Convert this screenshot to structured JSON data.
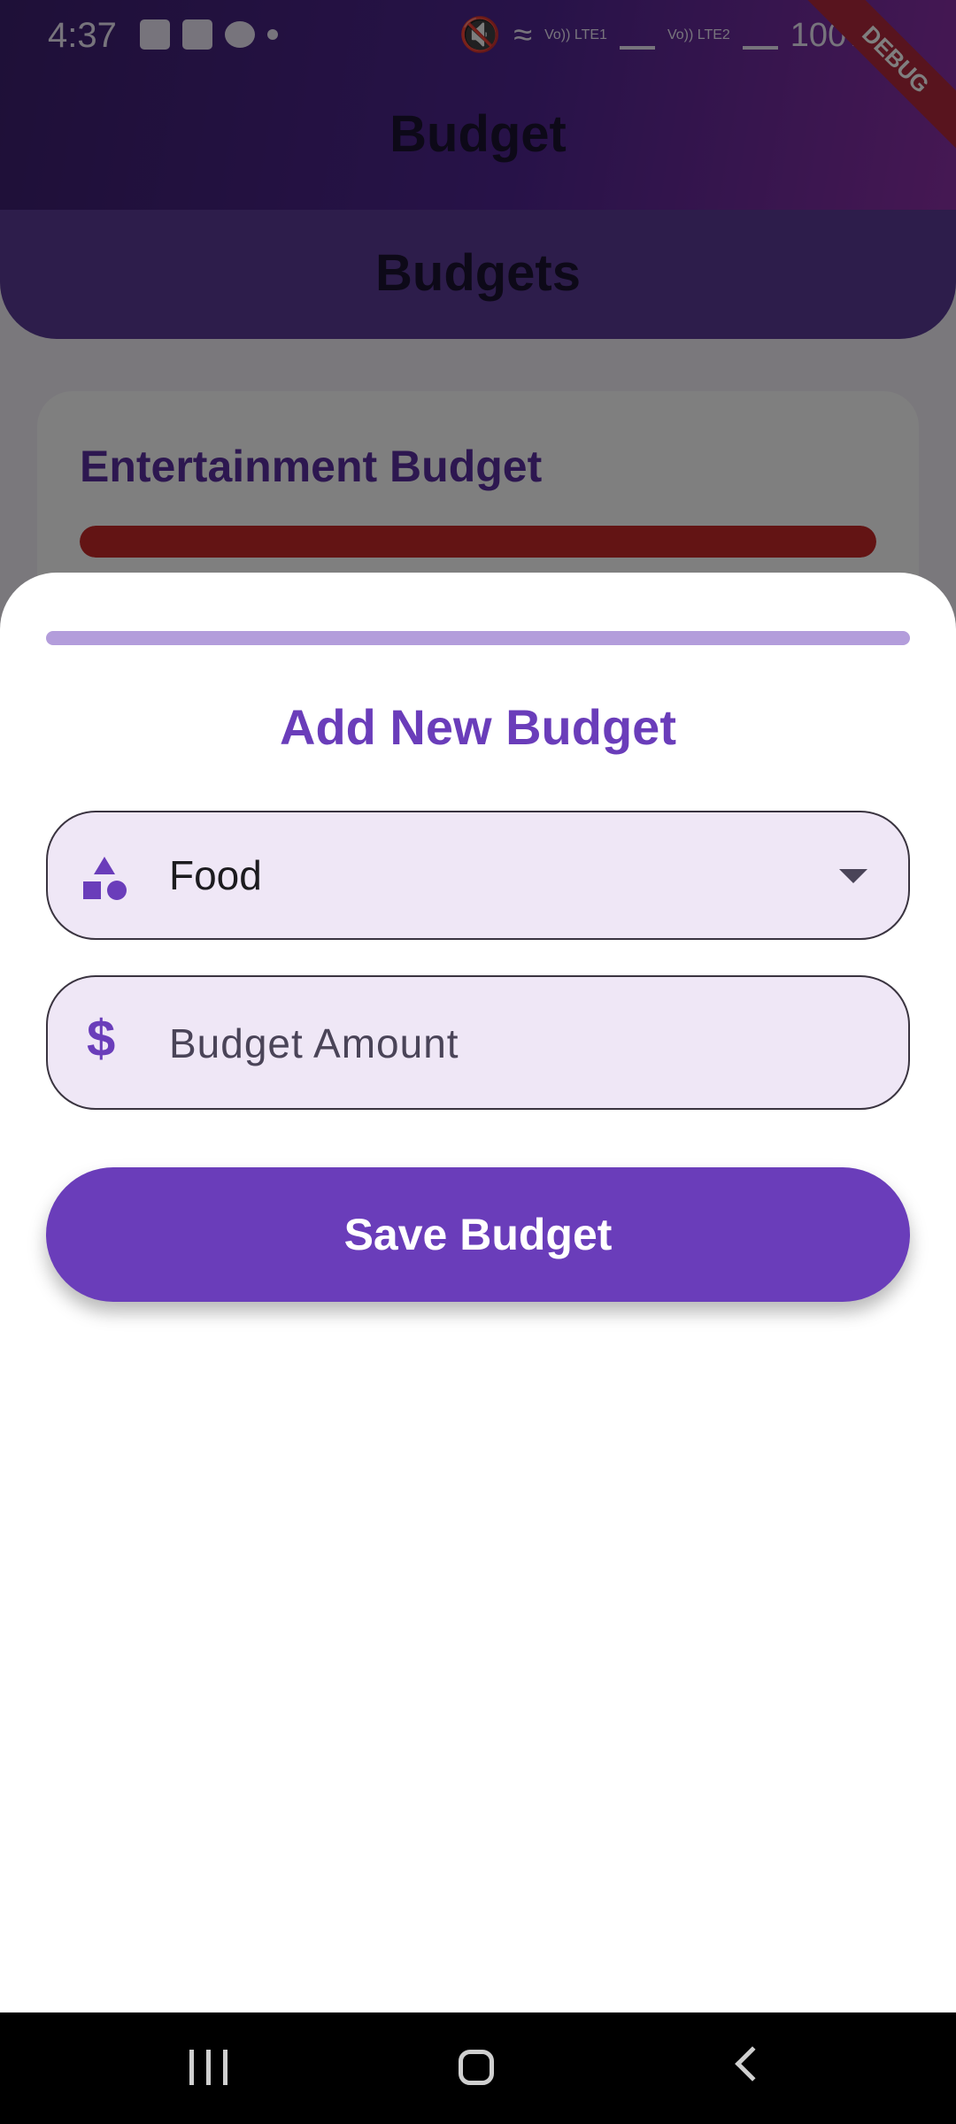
{
  "status_bar": {
    "time": "4:37",
    "battery": "100%",
    "sim1": "Vo)) LTE1",
    "sim2": "Vo)) LTE2",
    "debug_banner": "DEBUG"
  },
  "app_bar": {
    "title": "Budget"
  },
  "header": {
    "title": "Budgets"
  },
  "background_card": {
    "title": "Entertainment Budget",
    "progress": 1.0,
    "progress_color": "#c62828"
  },
  "sheet": {
    "title": "Add New Budget",
    "category": {
      "selected": "Food",
      "icon": "category-shapes-icon"
    },
    "amount": {
      "placeholder": "Budget Amount",
      "value": "",
      "icon": "dollar-icon"
    },
    "save_label": "Save Budget"
  },
  "colors": {
    "accent": "#6a3dba",
    "handle": "#b39ddb",
    "field_bg": "#efe7f6"
  },
  "nav_bar": {
    "icons": [
      "recent-apps-icon",
      "home-icon",
      "back-icon"
    ]
  }
}
